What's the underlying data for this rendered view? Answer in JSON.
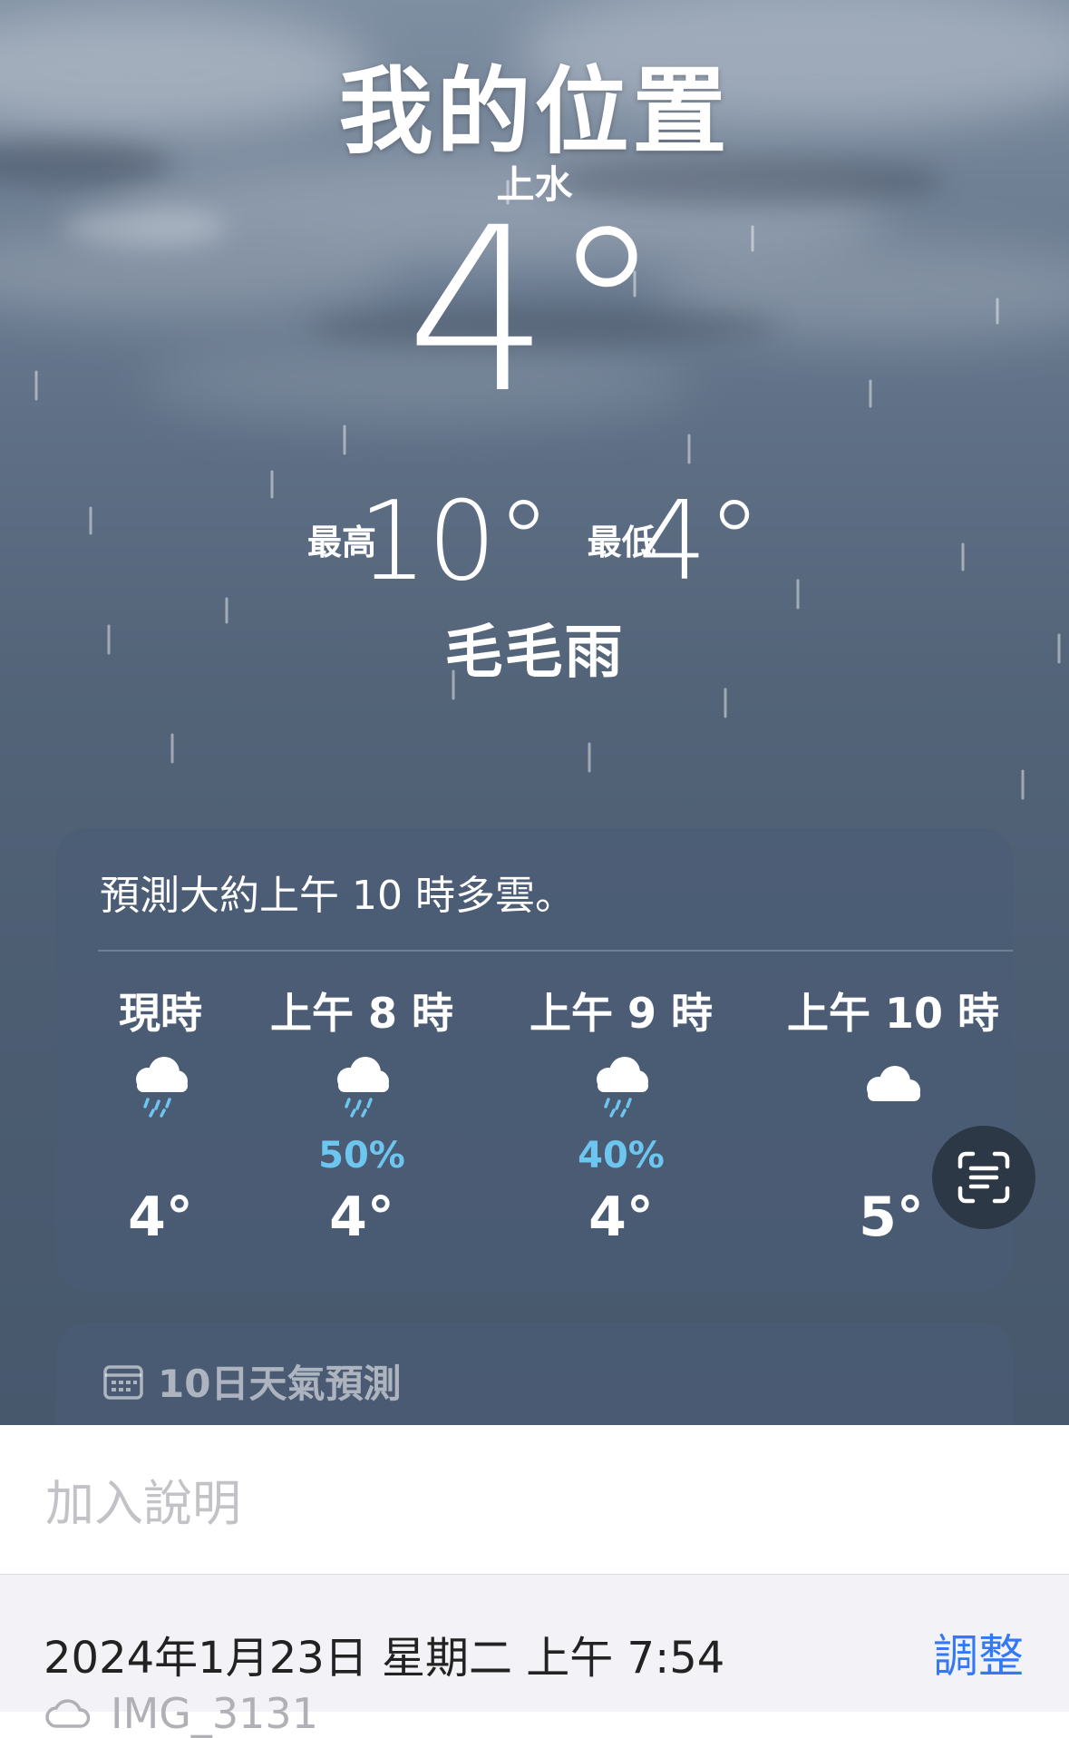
{
  "weather": {
    "location_title": "我的位置",
    "place": "上水",
    "current_temp": "4°",
    "high_label": "最高",
    "high_value": "10°",
    "low_label": "最低",
    "low_value": "4°",
    "condition": "毛毛雨"
  },
  "hourly": {
    "summary": "預測大約上午 10 時多雲。",
    "items": [
      {
        "label": "現時",
        "icon": "cloud-drizzle-icon",
        "pop": "",
        "temp": "4°"
      },
      {
        "label": "上午 8 時",
        "icon": "cloud-drizzle-icon",
        "pop": "50%",
        "temp": "4°"
      },
      {
        "label": "上午 9 時",
        "icon": "cloud-drizzle-icon",
        "pop": "40%",
        "temp": "4°"
      },
      {
        "label": "上午 10 時",
        "icon": "cloud-icon",
        "pop": "",
        "temp": "5°"
      }
    ]
  },
  "forecast": {
    "header": "10日天氣預測",
    "icon": "calendar-icon"
  },
  "photo_info": {
    "caption_placeholder": "加入說明",
    "datetime": "2024年1月23日 星期二 上午 7:54",
    "adjust_label": "調整",
    "filename": "IMG_3131",
    "file_icon": "cloud-icon"
  },
  "colors": {
    "precip_blue": "#6cc6f0",
    "link_blue": "#3478f6"
  }
}
